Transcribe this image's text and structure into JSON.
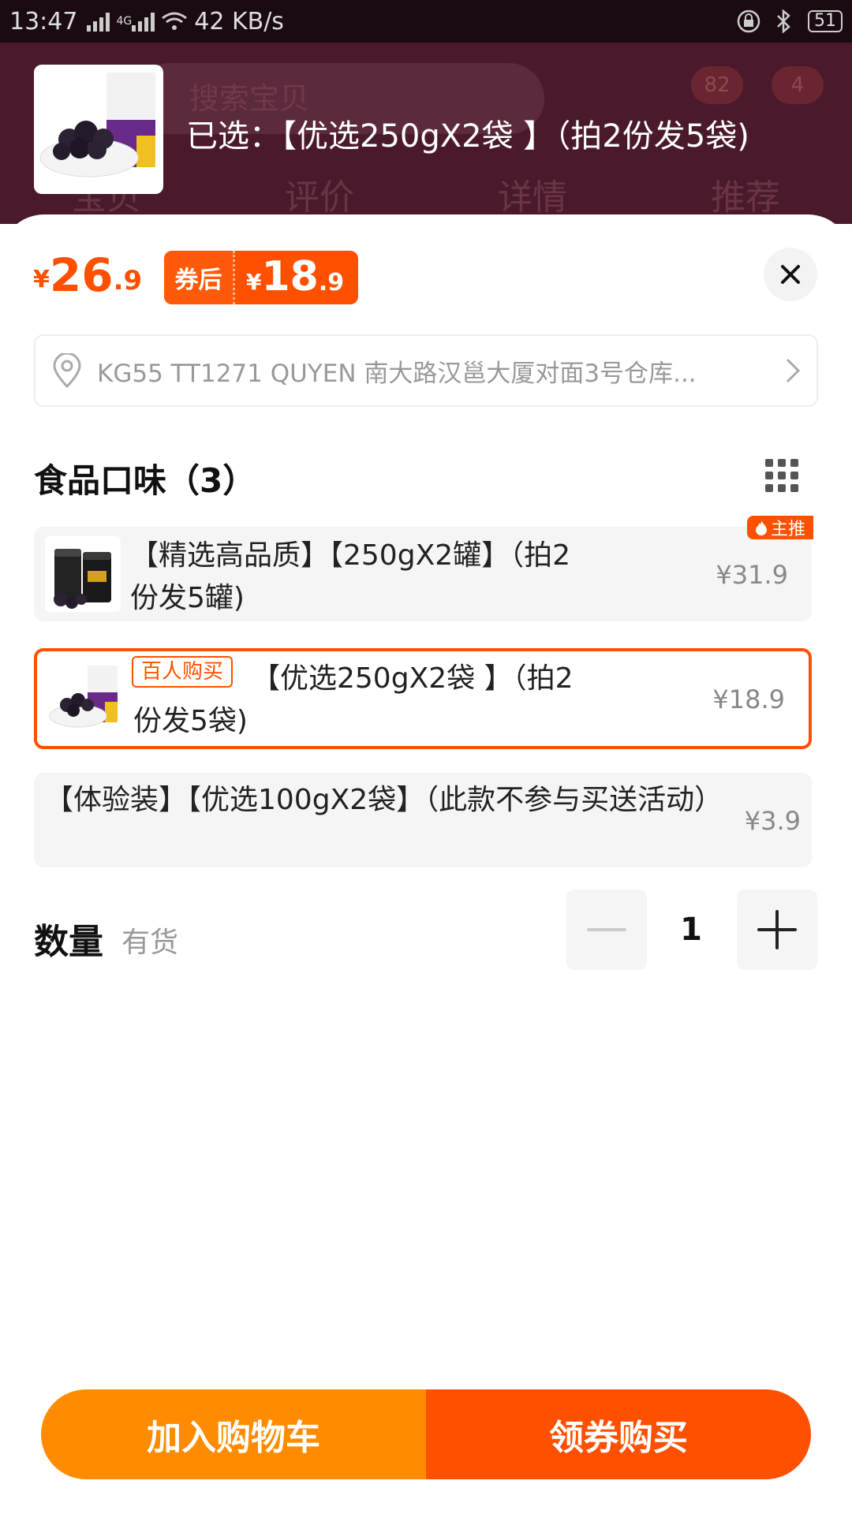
{
  "status_bar": {
    "time": "13:47",
    "network": "4G",
    "speed": "42 KB/s",
    "battery": "51"
  },
  "background_page": {
    "search_placeholder": "搜索宝贝",
    "cart_badge": "82",
    "more_badge": "4",
    "tabs": [
      "宝贝",
      "评价",
      "详情",
      "推荐"
    ]
  },
  "header": {
    "selected_label": "已选：【优选250gX2袋 】（拍2份发5袋)"
  },
  "price": {
    "currency": "¥",
    "original_int": "26",
    "original_dec": ".9",
    "coupon_tag": "券后",
    "coupon_int": "18",
    "coupon_dec": ".9"
  },
  "address": {
    "text": "KG55 TT1271 QUYEN 南大路汉邕大厦对面3号仓库..."
  },
  "section": {
    "title": "食品口味（3）"
  },
  "options": [
    {
      "name": "【精选高品质】【250gX2罐】（拍2份发5罐)",
      "price": "¥31.9",
      "tag": "主推"
    },
    {
      "name": "【优选250gX2袋 】（拍2份发5袋)",
      "price": "¥18.9",
      "tag": "百人购买"
    },
    {
      "name": "【体验装】【优选100gX2袋】（此款不参与买送活动）",
      "price": "¥3.9"
    }
  ],
  "quantity": {
    "label": "数量",
    "stock": "有货",
    "value": "1"
  },
  "actions": {
    "add_to_cart": "加入购物车",
    "buy": "领券购买"
  },
  "colors": {
    "accent": "#ff5000",
    "cart_button": "#ff8c00"
  }
}
